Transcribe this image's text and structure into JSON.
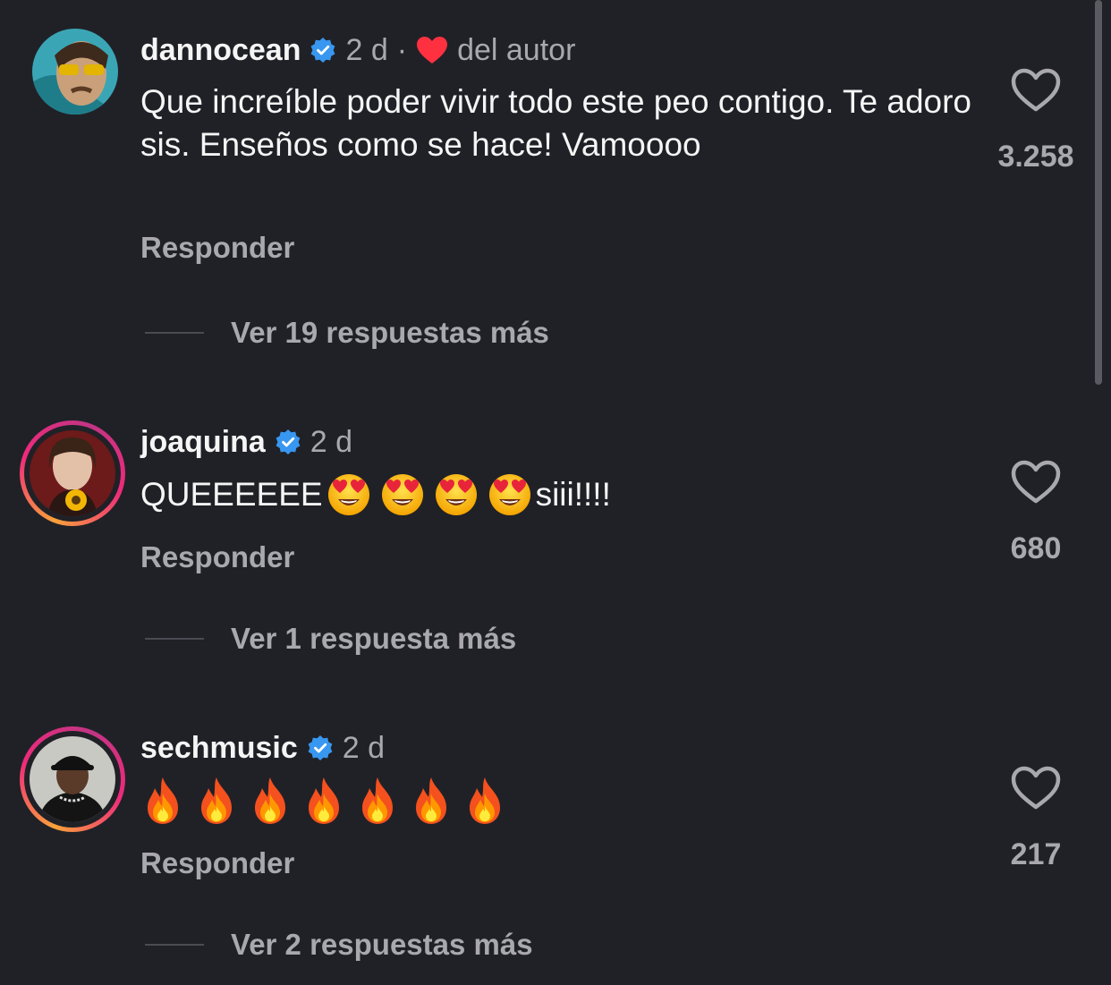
{
  "comments": [
    {
      "username": "dannocean",
      "time": "2 d",
      "separator": "·",
      "author_liked_label": "del autor",
      "text": "Que increíble poder vivir todo este peo contigo. Te adoro sis. Enseños como se hace! Vamoooo",
      "reply_label": "Responder",
      "view_replies_label": "Ver 19 respuestas más",
      "like_count": "3.258"
    },
    {
      "username": "joaquina",
      "time": "2 d",
      "text_prefix": "QUEEEEEE",
      "emoji_count": 4,
      "emoji_icon": "heart-eyes-emoji",
      "text_suffix": "siii!!!!",
      "reply_label": "Responder",
      "view_replies_label": "Ver 1 respuesta más",
      "like_count": "680"
    },
    {
      "username": "sechmusic",
      "time": "2 d",
      "emoji_count": 7,
      "emoji_icon": "fire-emoji",
      "reply_label": "Responder",
      "view_replies_label": "Ver 2 respuestas más",
      "like_count": "217"
    }
  ],
  "colors": {
    "background": "#202127",
    "verified_badge": "#3897f0",
    "author_heart": "#ff3040",
    "secondary_text": "#a8a8ad"
  }
}
